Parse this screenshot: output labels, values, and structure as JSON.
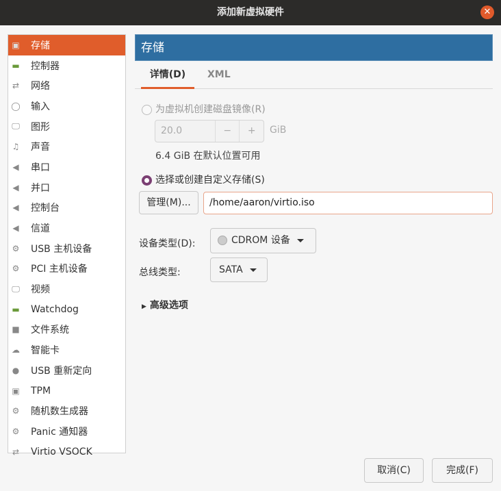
{
  "window": {
    "title": "添加新虚拟硬件"
  },
  "sidebar": {
    "items": [
      {
        "label": "存储",
        "icon": "disk-icon"
      },
      {
        "label": "控制器",
        "icon": "controller-icon"
      },
      {
        "label": "网络",
        "icon": "network-icon"
      },
      {
        "label": "输入",
        "icon": "mouse-icon"
      },
      {
        "label": "图形",
        "icon": "monitor-icon"
      },
      {
        "label": "声音",
        "icon": "sound-icon"
      },
      {
        "label": "串口",
        "icon": "serial-icon"
      },
      {
        "label": "并口",
        "icon": "parallel-icon"
      },
      {
        "label": "控制台",
        "icon": "console-icon"
      },
      {
        "label": "信道",
        "icon": "channel-icon"
      },
      {
        "label": "USB 主机设备",
        "icon": "usb-icon"
      },
      {
        "label": "PCI 主机设备",
        "icon": "pci-icon"
      },
      {
        "label": "视频",
        "icon": "video-icon"
      },
      {
        "label": "Watchdog",
        "icon": "watchdog-icon"
      },
      {
        "label": "文件系统",
        "icon": "filesystem-icon"
      },
      {
        "label": "智能卡",
        "icon": "smartcard-icon"
      },
      {
        "label": "USB 重新定向",
        "icon": "usb-redirect-icon"
      },
      {
        "label": "TPM",
        "icon": "tpm-icon"
      },
      {
        "label": "随机数生成器",
        "icon": "rng-icon"
      },
      {
        "label": "Panic 通知器",
        "icon": "panic-icon"
      },
      {
        "label": "Virtio VSOCK",
        "icon": "vsock-icon"
      }
    ]
  },
  "main": {
    "header": "存储",
    "tabs": [
      "详情(D)",
      "XML"
    ],
    "create_disk_label": "为虚拟机创建磁盘镜像(R)",
    "size_value": "20.0",
    "minus": "−",
    "plus": "+",
    "size_unit": "GiB",
    "available": "6.4 GiB 在默认位置可用",
    "custom_label": "选择或创建自定义存储(S)",
    "manage_button": "管理(M)...",
    "path_value": "/home/aaron/virtio.iso",
    "device_type_label": "设备类型(D):",
    "device_type_value": "CDROM 设备",
    "bus_type_label": "总线类型:",
    "bus_type_value": "SATA",
    "advanced": "高级选项"
  },
  "footer": {
    "cancel": "取消(C)",
    "finish": "完成(F)"
  },
  "colors": {
    "accent": "#e05d2b",
    "header": "#2e6ea1",
    "radio": "#7b3f73"
  }
}
